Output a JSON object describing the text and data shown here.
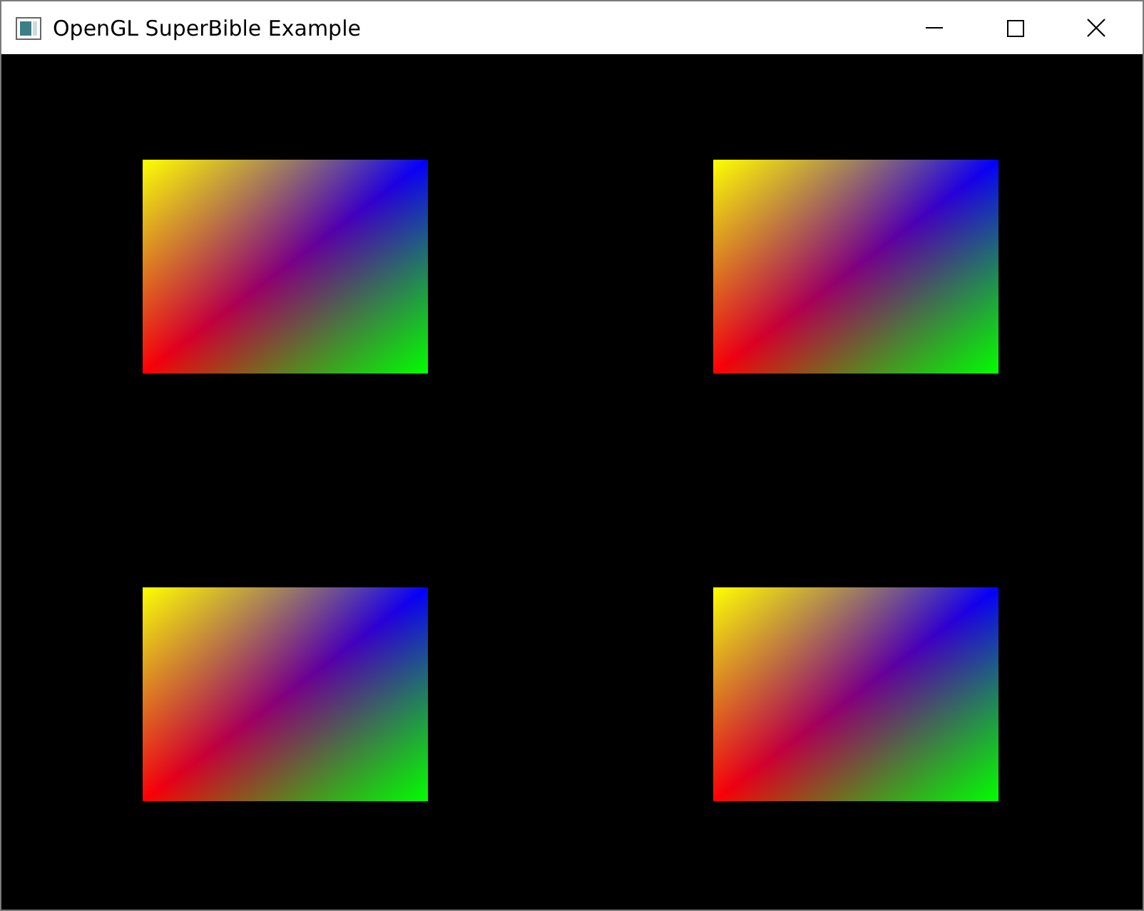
{
  "window": {
    "title": "OpenGL SuperBible Example"
  },
  "canvas": {
    "shapes": [
      {
        "kind": "gradient-rectangle"
      },
      {
        "kind": "gradient-rectangle"
      },
      {
        "kind": "gradient-rectangle"
      },
      {
        "kind": "gradient-rectangle"
      }
    ]
  }
}
